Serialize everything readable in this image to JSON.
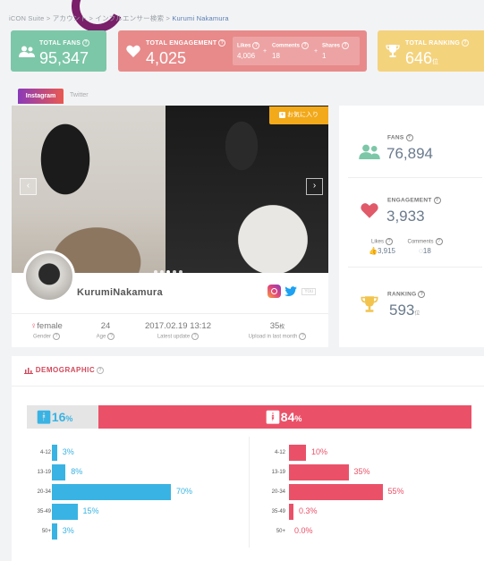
{
  "breadcrumb": [
    "iCON Suite",
    "アカウント",
    "インフルエンサー検索",
    "Kurumi Nakamura"
  ],
  "breadcrumb_sep": ">",
  "summary": {
    "fans": {
      "label": "TOTAL FANS",
      "value": "95,347",
      "color": "#7cc7a8"
    },
    "engagement": {
      "label": "TOTAL ENGAGEMENT",
      "value": "4,025",
      "color": "#e88a8a",
      "likes": {
        "label": "Likes",
        "value": "4,006"
      },
      "comments": {
        "label": "Comments",
        "value": "18"
      },
      "shares": {
        "label": "Shares",
        "value": "1"
      }
    },
    "ranking": {
      "label": "TOTAL RANKING",
      "value": "646",
      "suffix": "位",
      "color": "#f4d37d"
    }
  },
  "tabs": [
    {
      "label": "Instagram",
      "active": true
    },
    {
      "label": "Twitter",
      "active": false
    }
  ],
  "profile": {
    "favorite_label": "お気に入り",
    "name": "KurumiNakamura",
    "gender": {
      "value": "female",
      "label": "Gender"
    },
    "age": {
      "value": "24",
      "label": "Age"
    },
    "latest_update": {
      "value": "2017.02.19 13:12",
      "label": "Latest update"
    },
    "uploads": {
      "value": "35",
      "suffix": "枚",
      "label": "Upload in last month"
    },
    "carousel_dots": 5,
    "social_icons": [
      "instagram-icon",
      "twitter-icon",
      "youtube-icon"
    ]
  },
  "stats": {
    "fans": {
      "label": "FANS",
      "value": "76,894",
      "icon": "users-icon",
      "color": "#7cc7a8"
    },
    "engagement": {
      "label": "ENGAGEMENT",
      "value": "3,933",
      "icon": "heart-icon",
      "color": "#e88a8a"
    },
    "likes": {
      "label": "Likes",
      "value": "3,915"
    },
    "comments": {
      "label": "Comments",
      "value": "18"
    },
    "ranking": {
      "label": "RANKING",
      "value": "593",
      "suffix": "位",
      "icon": "trophy-icon",
      "color": "#f4d37d"
    }
  },
  "demographic": {
    "title": "DEMOGRAPHIC",
    "male_pct": "16",
    "female_pct": "84",
    "pct_sign": "%",
    "male_color": "#39b3e3",
    "female_color": "#ea5168",
    "age_groups": [
      "4-12",
      "13-19",
      "20-34",
      "35-49",
      "50+"
    ],
    "male": [
      3,
      8,
      70,
      15,
      3
    ],
    "female": [
      10,
      35,
      55,
      0.3,
      0.0
    ],
    "male_labels": [
      "3%",
      "8%",
      "70%",
      "15%",
      "3%"
    ],
    "female_labels": [
      "10%",
      "35%",
      "55%",
      "0.3%",
      "0.0%"
    ]
  }
}
